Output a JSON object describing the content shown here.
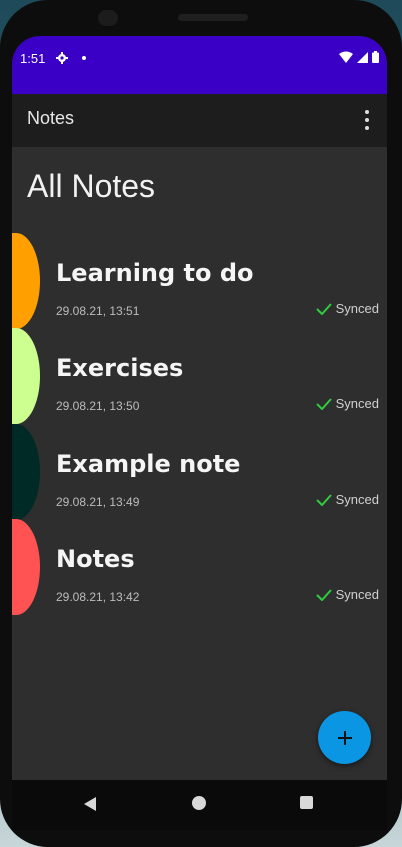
{
  "status_bar": {
    "time": "1:51",
    "icons": [
      "gear-icon",
      "dot-icon",
      "wifi-icon",
      "signal-icon",
      "battery-icon"
    ]
  },
  "app_bar": {
    "title": "Notes",
    "menu_icon": "more-vert-icon"
  },
  "main": {
    "title": "All Notes",
    "notes": [
      {
        "title": "Learning to do",
        "date": "29.08.21, 13:51",
        "status": "Synced",
        "color": "#ffa000"
      },
      {
        "title": "Exercises",
        "date": "29.08.21, 13:50",
        "status": "Synced",
        "color": "#ccff90"
      },
      {
        "title": "Example note",
        "date": "29.08.21, 13:49",
        "status": "Synced",
        "color": "#002a26"
      },
      {
        "title": "Notes",
        "date": "29.08.21, 13:42",
        "status": "Synced",
        "color": "#ff5252"
      }
    ]
  },
  "fab": {
    "icon": "plus-icon",
    "color": "#0b96e3"
  },
  "nav_bar": {
    "icons": [
      "back-icon",
      "home-icon",
      "recents-icon"
    ]
  },
  "colors": {
    "status_bar": "#3a00c6",
    "app_bar": "#1d1d1d",
    "background": "#2e2e2e",
    "synced_check": "#2ecc40"
  }
}
